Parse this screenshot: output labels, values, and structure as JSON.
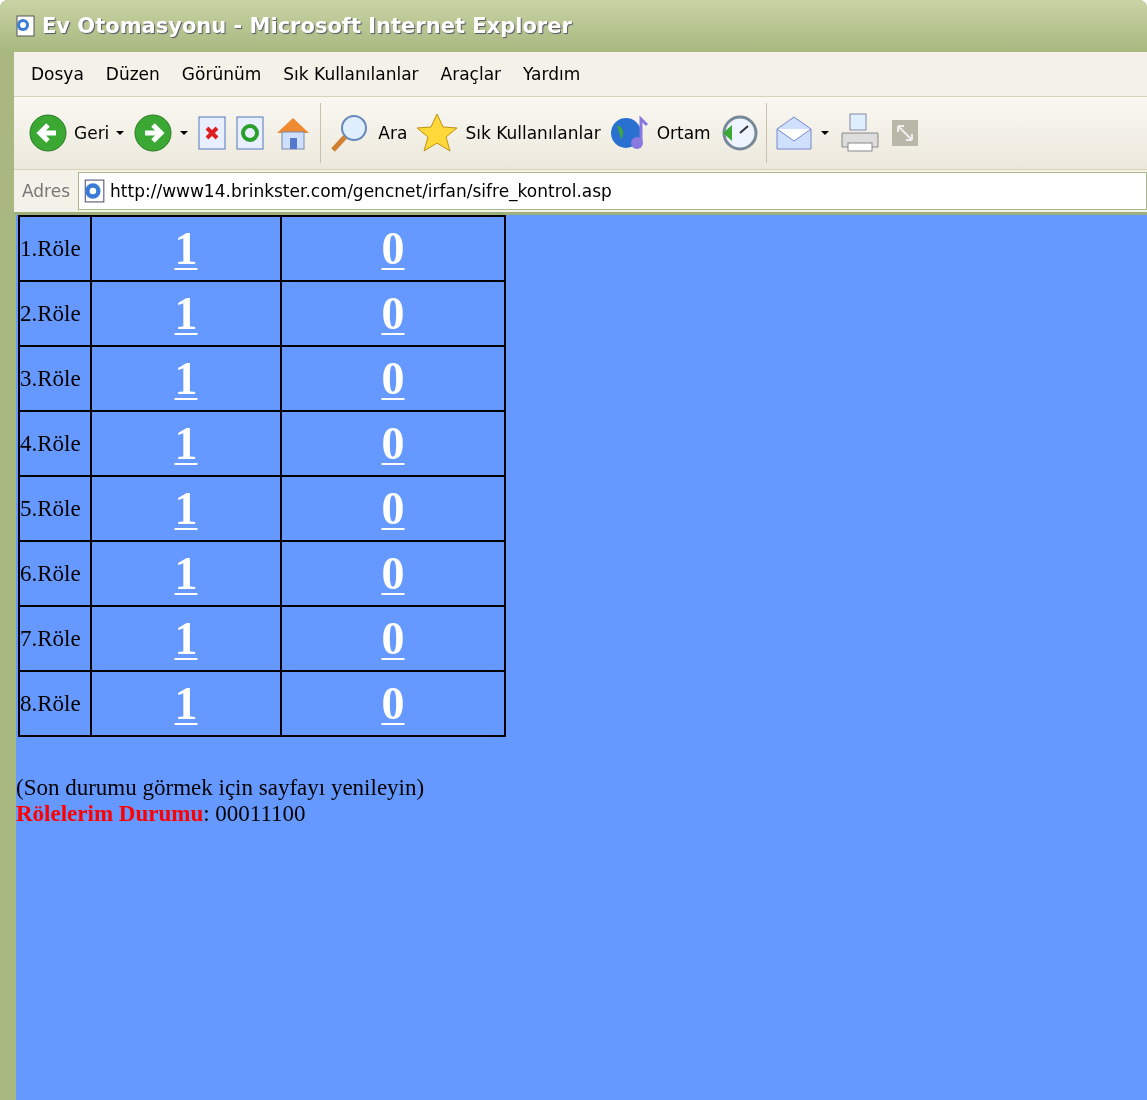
{
  "window": {
    "title": "Ev Otomasyonu - Microsoft Internet Explorer"
  },
  "menu": [
    "Dosya",
    "Düzen",
    "Görünüm",
    "Sık Kullanılanlar",
    "Araçlar",
    "Yardım"
  ],
  "toolbar": [
    {
      "kind": "back",
      "label": "Geri"
    },
    {
      "kind": "forward"
    },
    {
      "kind": "stop"
    },
    {
      "kind": "refresh"
    },
    {
      "kind": "home"
    },
    {
      "kind": "sep"
    },
    {
      "kind": "search",
      "label": "Ara"
    },
    {
      "kind": "favorites",
      "label": "Sık Kullanılanlar"
    },
    {
      "kind": "media",
      "label": "Ortam"
    },
    {
      "kind": "history"
    },
    {
      "kind": "sep"
    },
    {
      "kind": "mail"
    },
    {
      "kind": "print"
    },
    {
      "kind": "resize"
    }
  ],
  "address": {
    "label": "Adres",
    "url": "http://www14.brinkster.com/gencnet/irfan/sifre_kontrol.asp"
  },
  "relays": [
    {
      "name": "1.Röle",
      "on": "1",
      "off": "0"
    },
    {
      "name": "2.Röle",
      "on": "1",
      "off": "0"
    },
    {
      "name": "3.Röle",
      "on": "1",
      "off": "0"
    },
    {
      "name": "4.Röle",
      "on": "1",
      "off": "0"
    },
    {
      "name": "5.Röle",
      "on": "1",
      "off": "0"
    },
    {
      "name": "6.Röle",
      "on": "1",
      "off": "0"
    },
    {
      "name": "7.Röle",
      "on": "1",
      "off": "0"
    },
    {
      "name": "8.Röle",
      "on": "1",
      "off": "0"
    }
  ],
  "note": "(Son durumu görmek için sayfayı yenileyin)",
  "status": {
    "label": "Rölelerim Durumu",
    "value": ": 00011100"
  }
}
